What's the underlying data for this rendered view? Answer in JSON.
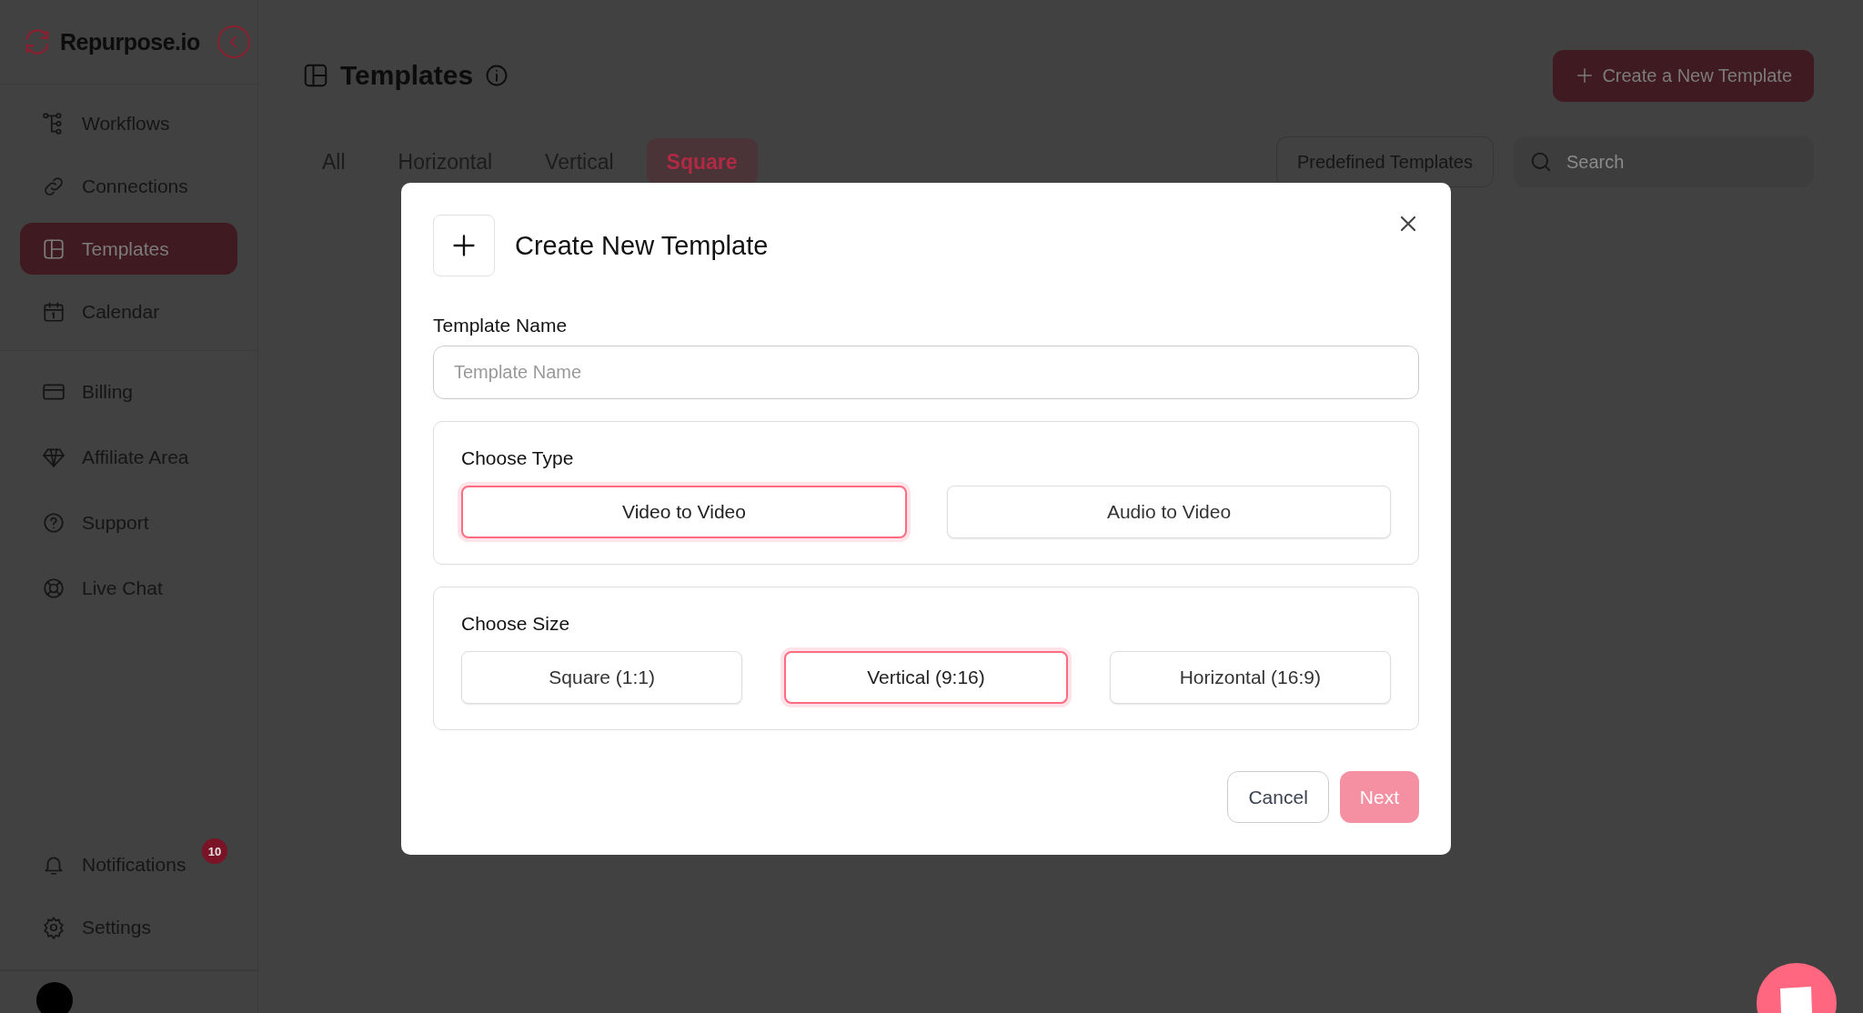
{
  "sidebar": {
    "logo": "Repurpose.io",
    "groups": [
      [
        {
          "label": "Workflows",
          "selected": false
        },
        {
          "label": "Connections",
          "selected": false
        },
        {
          "label": "Templates",
          "selected": true
        },
        {
          "label": "Calendar",
          "selected": false
        }
      ],
      [
        {
          "label": "Billing",
          "selected": false
        },
        {
          "label": "Affiliate Area",
          "selected": false
        },
        {
          "label": "Support",
          "selected": false
        },
        {
          "label": "Live Chat",
          "selected": false
        }
      ],
      [
        {
          "label": "Notifications",
          "selected": false,
          "badge": "10"
        },
        {
          "label": "Settings",
          "selected": false
        }
      ]
    ]
  },
  "header": {
    "title": "Templates",
    "create_button": "Create a New Template"
  },
  "tabs": [
    {
      "label": "All",
      "selected": false
    },
    {
      "label": "Horizontal",
      "selected": false
    },
    {
      "label": "Vertical",
      "selected": false
    },
    {
      "label": "Square",
      "selected": true
    }
  ],
  "predefined_button": "Predefined Templates",
  "search": {
    "placeholder": "Search"
  },
  "modal": {
    "title": "Create New Template",
    "name_label": "Template Name",
    "name_field": {
      "placeholder": "Template Name"
    },
    "type_section": {
      "title": "Choose Type",
      "options": [
        {
          "label": "Video to Video",
          "selected": true
        },
        {
          "label": "Audio to Video",
          "selected": false
        }
      ]
    },
    "size_section": {
      "title": "Choose Size",
      "options": [
        {
          "label": "Square (1:1)",
          "selected": false
        },
        {
          "label": "Vertical (9:16)",
          "selected": true
        },
        {
          "label": "Horizontal (16:9)",
          "selected": false
        }
      ]
    },
    "cancel_button": "Cancel",
    "next_button": {
      "label": "Next",
      "disabled": true
    }
  }
}
